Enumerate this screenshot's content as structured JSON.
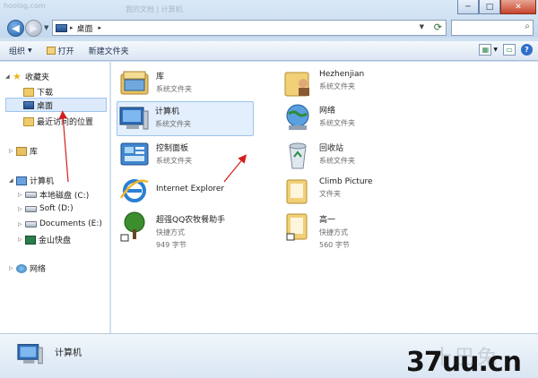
{
  "window": {
    "faded_title": "hoolog.com",
    "faded_tab": "我的文档 | 计算机",
    "minimize_label": "─",
    "maximize_label": "□",
    "close_label": "✕"
  },
  "address": {
    "location": "桌面",
    "separator": "▸",
    "arrow": "▸"
  },
  "search": {
    "placeholder": ""
  },
  "toolbar": {
    "organize": "组织",
    "open": "打开",
    "new_folder": "新建文件夹"
  },
  "sidebar": {
    "favorites": "收藏夹",
    "downloads": "下载",
    "desktop": "桌面",
    "recent": "最近访问的位置",
    "libraries": "库",
    "computer": "计算机",
    "drives": [
      "本地磁盘 (C:)",
      "Soft (D:)",
      "Documents (E:)",
      "金山快盘"
    ],
    "network": "网络"
  },
  "items": [
    {
      "name": "库",
      "sub": "系统文件夹",
      "icon": "library-folder-icon"
    },
    {
      "name": "Hezhenjian",
      "sub": "系统文件夹",
      "icon": "user-folder-icon"
    },
    {
      "name": "计算机",
      "sub": "系统文件夹",
      "icon": "computer-icon"
    },
    {
      "name": "网络",
      "sub": "系统文件夹",
      "icon": "network-icon"
    },
    {
      "name": "控制面板",
      "sub": "系统文件夹",
      "icon": "control-panel-icon"
    },
    {
      "name": "回收站",
      "sub": "系统文件夹",
      "icon": "recycle-bin-icon"
    },
    {
      "name": "Internet Explorer",
      "sub": "",
      "icon": "internet-explorer-icon"
    },
    {
      "name": "Climb Picture",
      "sub": "文件夹",
      "icon": "folder-icon"
    },
    {
      "name": "超强QQ农牧餐助手",
      "sub": "快捷方式",
      "sub2": "949 字节",
      "icon": "tree-shortcut-icon"
    },
    {
      "name": "高一",
      "sub": "快捷方式",
      "sub2": "560 字节",
      "icon": "folder-shortcut-icon"
    }
  ],
  "status": {
    "text": "计算机"
  },
  "watermark": {
    "faded": "十巴兔",
    "main": "37uu.cn"
  },
  "colors": {
    "accent": "#3a6fb8",
    "selection": "#dceafb",
    "arrow": "#d21f1f"
  }
}
